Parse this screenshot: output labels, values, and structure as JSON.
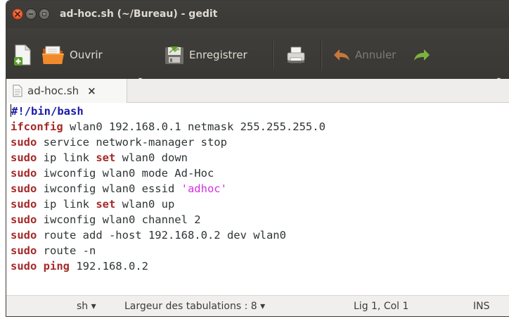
{
  "window": {
    "title": "ad-hoc.sh (~/Bureau) - gedit"
  },
  "toolbar": {
    "new_icon": "new-document-icon",
    "open_label": "Ouvrir",
    "open_menu_arrow": "▾",
    "save_label": "Enregistrer",
    "print_icon": "printer-icon",
    "undo_label": "Annuler",
    "redo_icon": "redo-icon",
    "overflow_arrow": "▾"
  },
  "tabs": [
    {
      "label": "ad-hoc.sh",
      "close": "×",
      "icon": "text-document-icon"
    }
  ],
  "editor": {
    "lines": [
      [
        {
          "t": "#!/bin/bash",
          "c": "sb"
        }
      ],
      [
        {
          "t": "ifconfig",
          "c": "kw"
        },
        {
          "t": " wlan0 192.168.0.1 netmask 255.255.255.0",
          "c": ""
        }
      ],
      [
        {
          "t": "sudo",
          "c": "kw"
        },
        {
          "t": " service network-manager stop",
          "c": ""
        }
      ],
      [
        {
          "t": "sudo",
          "c": "kw"
        },
        {
          "t": " ip link ",
          "c": ""
        },
        {
          "t": "set",
          "c": "kw"
        },
        {
          "t": " wlan0 down",
          "c": ""
        }
      ],
      [
        {
          "t": "sudo",
          "c": "kw"
        },
        {
          "t": " iwconfig wlan0 mode Ad-Hoc",
          "c": ""
        }
      ],
      [
        {
          "t": "sudo",
          "c": "kw"
        },
        {
          "t": " iwconfig wlan0 essid ",
          "c": ""
        },
        {
          "t": "'adhoc'",
          "c": "str"
        }
      ],
      [
        {
          "t": "sudo",
          "c": "kw"
        },
        {
          "t": " ip link ",
          "c": ""
        },
        {
          "t": "set",
          "c": "kw"
        },
        {
          "t": " wlan0 up",
          "c": ""
        }
      ],
      [
        {
          "t": "sudo",
          "c": "kw"
        },
        {
          "t": " iwconfig wlan0 channel 2",
          "c": ""
        }
      ],
      [
        {
          "t": "sudo",
          "c": "kw"
        },
        {
          "t": " route add -host 192.168.0.2 dev wlan0",
          "c": ""
        }
      ],
      [
        {
          "t": "sudo",
          "c": "kw"
        },
        {
          "t": " route -n",
          "c": ""
        }
      ],
      [
        {
          "t": "sudo",
          "c": "kw"
        },
        {
          "t": " ",
          "c": ""
        },
        {
          "t": "ping",
          "c": "kw"
        },
        {
          "t": " 192.168.0.2",
          "c": ""
        }
      ]
    ]
  },
  "statusbar": {
    "language": "sh ▾",
    "tab_width": "Largeur des tabulations : 8 ▾",
    "position": "Lig 1, Col 1",
    "mode": "INS"
  },
  "colors": {
    "keyword": "#a52a2a",
    "shebang": "#1a1aa6",
    "string": "#d62ee0",
    "titlebar": "#3c3b37"
  }
}
